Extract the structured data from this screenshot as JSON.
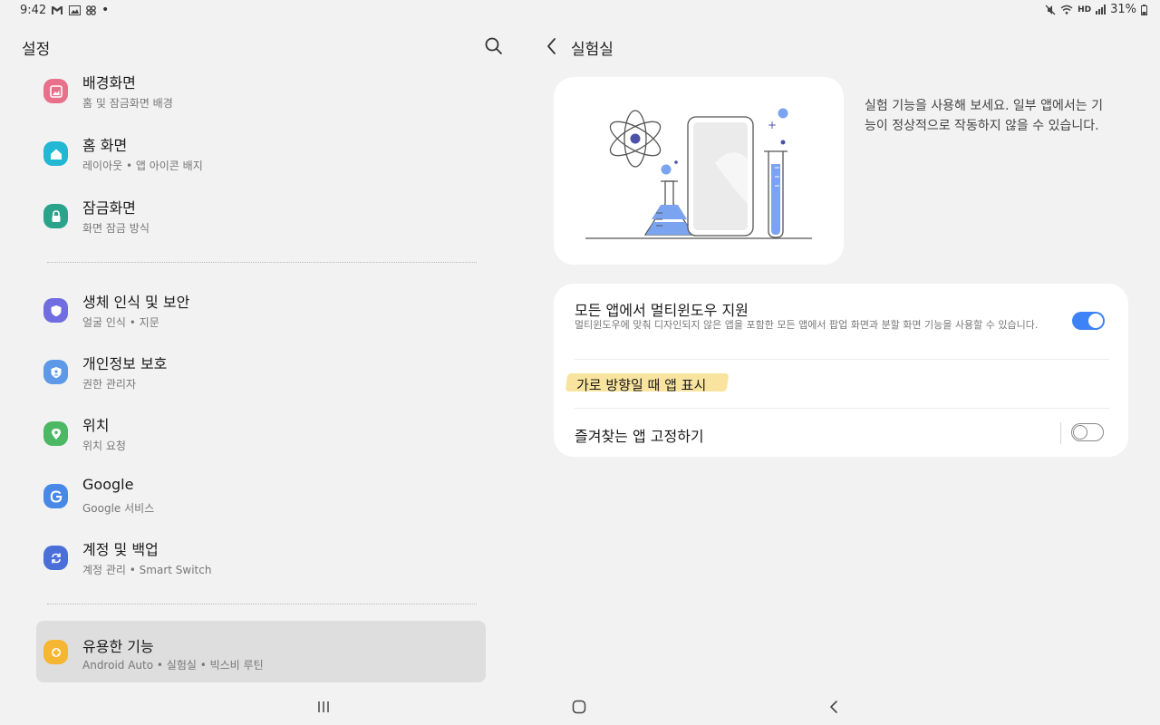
{
  "status_bar": {
    "time": "9:42",
    "left_icons": [
      "gmail-icon",
      "gallery-icon",
      "app-icon"
    ],
    "hd_label": "HD",
    "battery": "31%"
  },
  "left": {
    "title": "설정",
    "items": [
      {
        "title": "배경화면",
        "subtitle": "홈 및 잠금화면 배경",
        "icon": "wallpaper-icon",
        "color": "#e8708b"
      },
      {
        "title": "홈 화면",
        "subtitle": "레이아웃 • 앱 아이콘 배지",
        "icon": "home-icon",
        "color": "#22b8d4"
      },
      {
        "title": "잠금화면",
        "subtitle": "화면 잠금 방식",
        "icon": "lock-icon",
        "color": "#2aa38a"
      },
      {
        "title": "생체 인식 및 보안",
        "subtitle": "얼굴 인식 • 지문",
        "icon": "shield-icon",
        "color": "#6f6de0"
      },
      {
        "title": "개인정보 보호",
        "subtitle": "권한 관리자",
        "icon": "privacy-icon",
        "color": "#5d99e6"
      },
      {
        "title": "위치",
        "subtitle": "위치 요청",
        "icon": "location-icon",
        "color": "#4cb864"
      },
      {
        "title": "Google",
        "subtitle": "Google 서비스",
        "icon": "google-icon",
        "color": "#4a88e8"
      },
      {
        "title": "계정 및 백업",
        "subtitle": "계정 관리 • Smart Switch",
        "icon": "sync-icon",
        "color": "#4a6fd8"
      },
      {
        "title": "유용한 기능",
        "subtitle": "Android Auto • 실험실 • 빅스비 루틴",
        "icon": "puzzle-icon",
        "color": "#f5b631"
      }
    ]
  },
  "right": {
    "title": "실험실",
    "description": "실험 기능을 사용해 보세요. 일부 앱에서는 기능이 정상적으로 작동하지 않을 수 있습니다.",
    "rows": [
      {
        "title": "모든 앱에서 멀티윈도우 지원",
        "subtitle": "멀티윈도우에 맞춰 디자인되지 않은 앱을 포함한 모든 앱에서 팝업 화면과 분할 화면 기능을 사용할 수 있습니다.",
        "toggle": "on"
      },
      {
        "title": "가로 방향일 때 앱 표시"
      },
      {
        "title": "즐겨찾는 앱 고정하기",
        "toggle": "off"
      }
    ]
  },
  "colors": {
    "accent": "#3e82f7",
    "highlight": "#f8df8e",
    "selected_bg": "#dedede"
  }
}
